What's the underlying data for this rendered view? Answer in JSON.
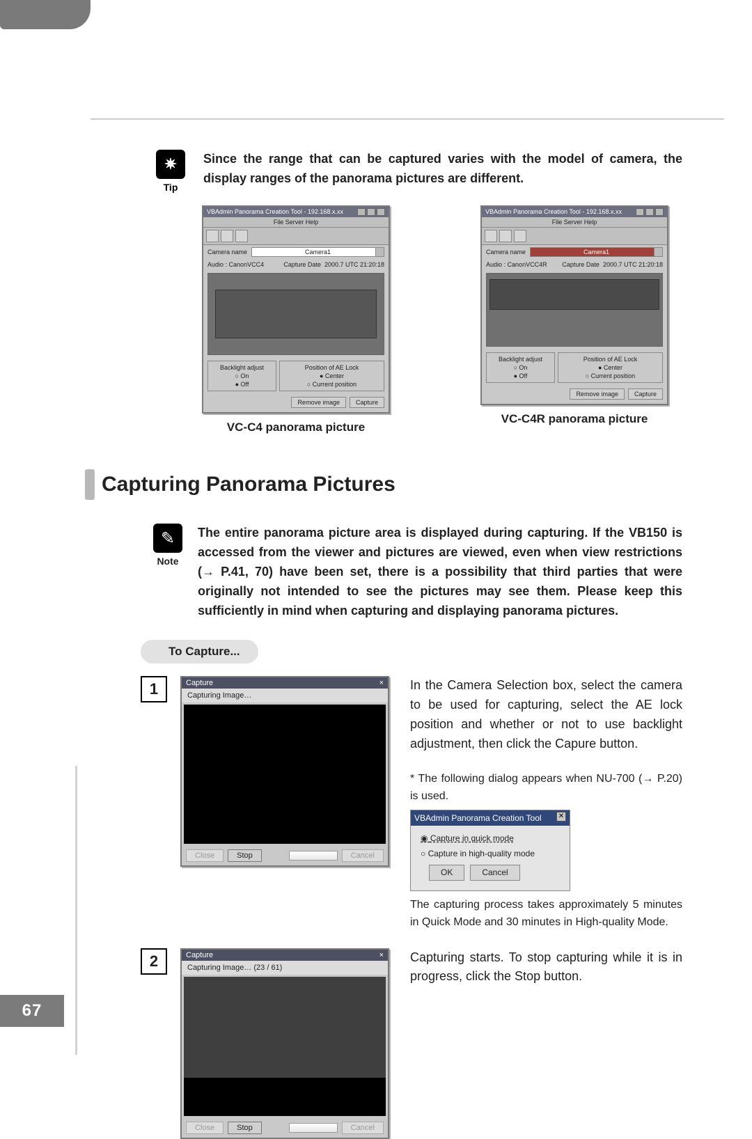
{
  "page_number": "67",
  "tip": {
    "label": "Tip",
    "text": "Since the range that can be captured varies with the model of camera, the display ranges of the panorama pictures are different."
  },
  "screens": {
    "common": {
      "title_prefix": "VBAdmin Panorama Creation Tool - 192.168.x.xx",
      "menu": "File   Server   Help",
      "camera_label": "Camera name",
      "audio_label": "Audio :",
      "capdate_label": "Capture Date",
      "capdate_val": "2000.7 UTC 21:20:18",
      "backlight_label": "Backlight adjust",
      "bl_on": "On",
      "bl_off": "Off",
      "aelock_label": "Position of AE Lock",
      "ae_center": "Center",
      "ae_current": "Current position",
      "btn_remove": "Remove image",
      "btn_capture": "Capture"
    },
    "left": {
      "camera_val": "Camera1",
      "audio_val": "CanonVCC4",
      "caption": "VC-C4 panorama picture"
    },
    "right": {
      "camera_val": "Camera1",
      "audio_val": "CanonVCC4R",
      "caption": "VC-C4R panorama picture"
    }
  },
  "section_title": "Capturing Panorama Pictures",
  "note": {
    "label": "Note",
    "text": "The entire panorama picture area is displayed during capturing. If the VB150 is accessed from the viewer and pictures are viewed, even when view restrictions (→ P.41, 70) have been set, there is a possibility that third parties that were originally not intended to see the pictures may see them. Please keep this sufficiently in mind when capturing and displaying panorama pictures."
  },
  "pill_label": "To Capture...",
  "steps": {
    "one": {
      "num": "1",
      "dlg_title": "Capture",
      "dlg_msg": "Capturing Image…",
      "dlg_stop": "Stop",
      "dlg_close": "Close",
      "dlg_cancel": "Cancel",
      "text": "In the Camera Selection box, select the camera to be used for capturing, select the AE lock position and whether or not to use backlight adjustment, then click the Capure button.",
      "note": "*  The following dialog appears when NU-700 (→ P.20) is used.",
      "mini": {
        "title": "VBAdmin Panorama Creation Tool",
        "opt1": "Capture in quick mode",
        "opt2": "Capture in high-quality mode",
        "ok": "OK",
        "cancel": "Cancel"
      },
      "after": "The capturing process takes approximately 5 minutes in Quick Mode and 30 minutes in High-quality Mode."
    },
    "two": {
      "num": "2",
      "dlg_title": "Capture",
      "dlg_msg": "Capturing Image…  (23 / 61)",
      "dlg_stop": "Stop",
      "dlg_close": "Close",
      "dlg_cancel": "Cancel",
      "text": "Capturing starts. To stop capturing while it is in progress, click the Stop button."
    }
  }
}
